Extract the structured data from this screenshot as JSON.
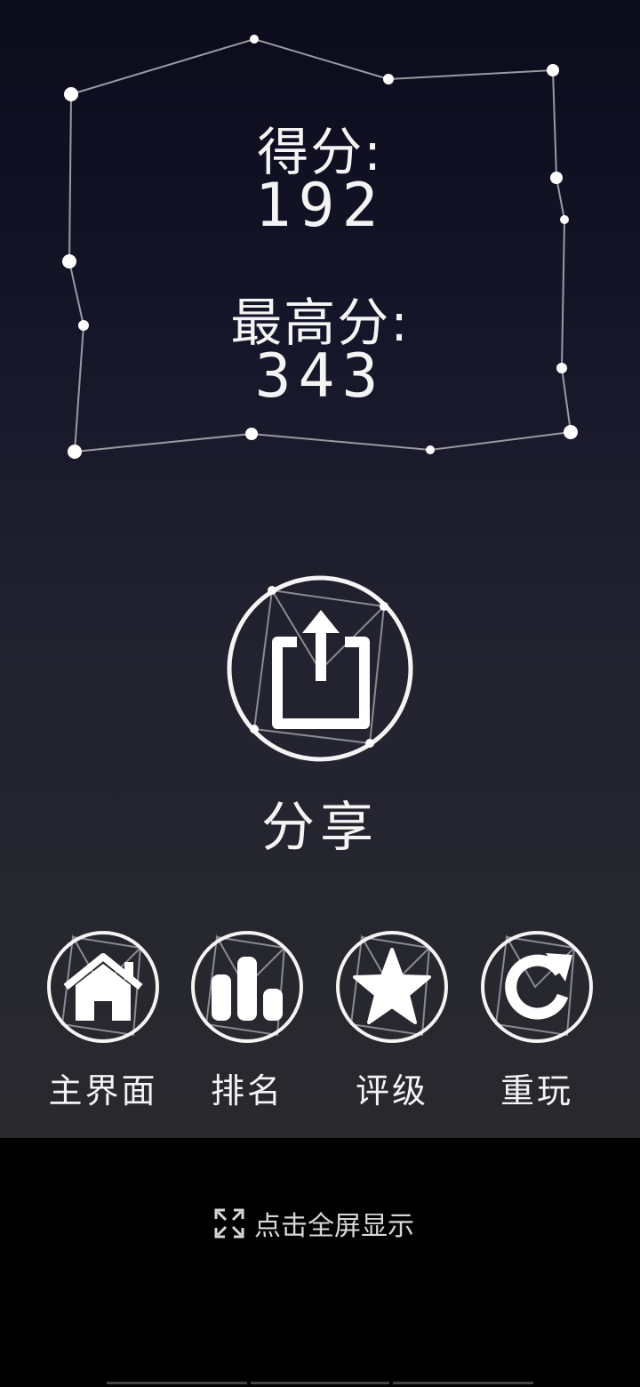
{
  "score": {
    "label": "得分:",
    "value": "192"
  },
  "best": {
    "label": "最高分:",
    "value": "343"
  },
  "share": {
    "label": "分享",
    "icon": "share-icon"
  },
  "buttons": [
    {
      "label": "主界面",
      "icon": "home-icon"
    },
    {
      "label": "排名",
      "icon": "bar-chart-icon"
    },
    {
      "label": "评级",
      "icon": "star-icon"
    },
    {
      "label": "重玩",
      "icon": "replay-icon"
    }
  ],
  "fullscreen": {
    "label": "点击全屏显示",
    "icon": "fullscreen-icon"
  },
  "colors": {
    "line": "#9a9aa2",
    "text": "#f4f4f4",
    "background_top": "#0b0b1c",
    "background_bottom": "#29292e"
  }
}
